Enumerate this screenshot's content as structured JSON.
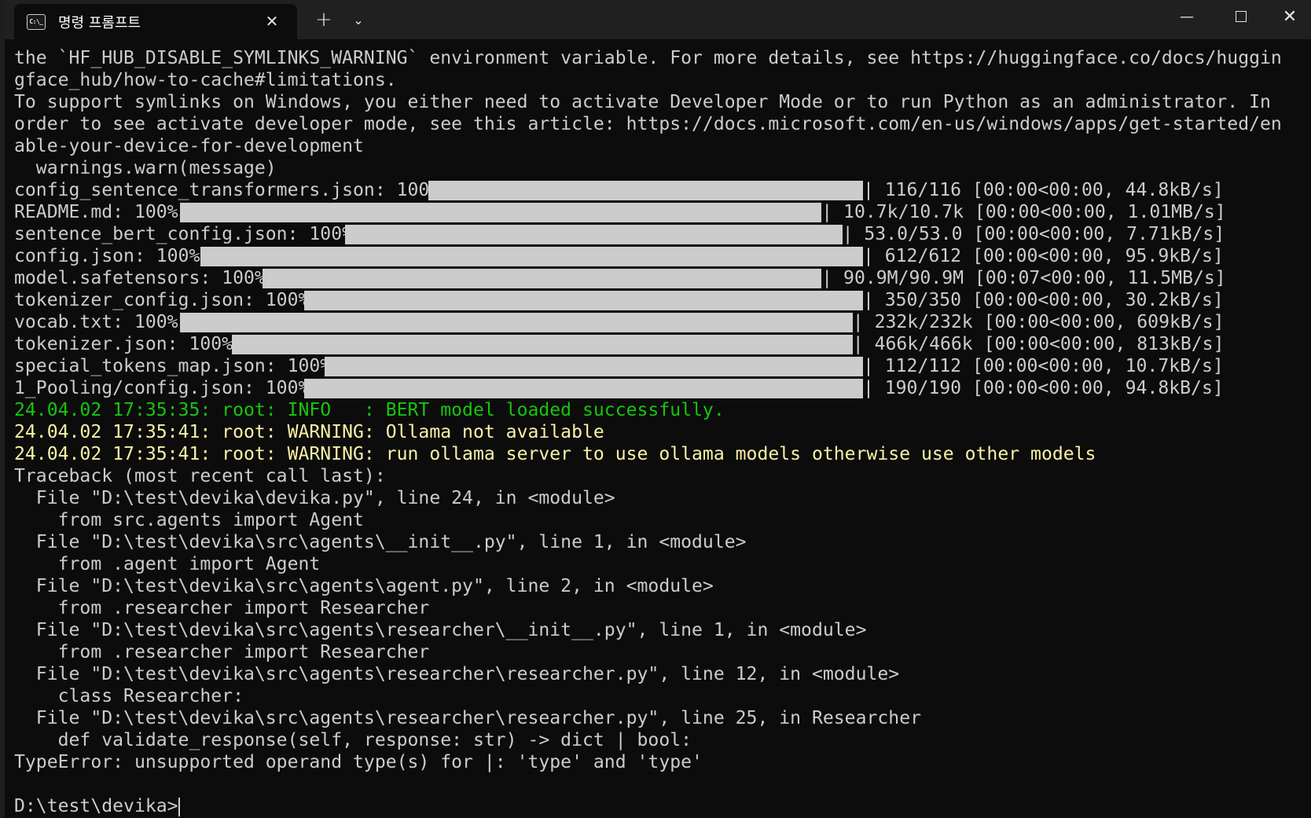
{
  "window": {
    "tab_title": "명령 프롬프트",
    "tab_icon_text": "C:\\_",
    "new_tab_symbol": "+",
    "dropdown_symbol": "⌄",
    "close_tab_symbol": "✕",
    "minimize_symbol": "—",
    "close_window_symbol": "✕"
  },
  "console": {
    "pre_lines": [
      "the `HF_HUB_DISABLE_SYMLINKS_WARNING` environment variable. For more details, see https://huggingface.co/docs/huggin",
      "gface_hub/how-to-cache#limitations.",
      "To support symlinks on Windows, you either need to activate Developer Mode or to run Python as an administrator. In",
      "order to see activate developer mode, see this article: https://docs.microsoft.com/en-us/windows/apps/get-started/en",
      "able-your-device-for-development",
      "  warnings.warn(message)"
    ],
    "downloads": [
      {
        "label": "config_sentence_transformers.json: 100%|",
        "stats": "| 116/116 [00:00<00:00, 44.8kB/s]",
        "progress": 1.0
      },
      {
        "label": "README.md: 100%|",
        "stats": "| 10.7k/10.7k [00:00<00:00, 1.01MB/s]",
        "progress": 1.0
      },
      {
        "label": "sentence_bert_config.json: 100%|",
        "stats": "| 53.0/53.0 [00:00<00:00, 7.71kB/s]",
        "progress": 1.0
      },
      {
        "label": "config.json: 100%|",
        "stats": "| 612/612 [00:00<00:00, 95.9kB/s]",
        "progress": 1.0
      },
      {
        "label": "model.safetensors: 100%|",
        "stats": "| 90.9M/90.9M [00:07<00:00, 11.5MB/s]",
        "progress": 1.0
      },
      {
        "label": "tokenizer_config.json: 100%|",
        "stats": "| 350/350 [00:00<00:00, 30.2kB/s]",
        "progress": 1.0
      },
      {
        "label": "vocab.txt: 100%|",
        "stats": "| 232k/232k [00:00<00:00, 609kB/s]",
        "progress": 1.0
      },
      {
        "label": "tokenizer.json: 100%|",
        "stats": "| 466k/466k [00:00<00:00, 813kB/s]",
        "progress": 1.0
      },
      {
        "label": "special_tokens_map.json: 100%|",
        "stats": "| 112/112 [00:00<00:00, 10.7kB/s]",
        "progress": 1.0
      },
      {
        "label": "1_Pooling/config.json: 100%|",
        "stats": "| 190/190 [00:00<00:00, 94.8kB/s]",
        "progress": 1.0
      }
    ],
    "log_lines": [
      {
        "text": "24.04.02 17:35:35: root: INFO   : BERT model loaded successfully.",
        "color": "#16c60c"
      },
      {
        "text": "24.04.02 17:35:41: root: WARNING: Ollama not available",
        "color": "#f9f1a5"
      },
      {
        "text": "24.04.02 17:35:41: root: WARNING: run ollama server to use ollama models otherwise use other models",
        "color": "#f9f1a5"
      }
    ],
    "traceback_lines": [
      "Traceback (most recent call last):",
      "  File \"D:\\test\\devika\\devika.py\", line 24, in <module>",
      "    from src.agents import Agent",
      "  File \"D:\\test\\devika\\src\\agents\\__init__.py\", line 1, in <module>",
      "    from .agent import Agent",
      "  File \"D:\\test\\devika\\src\\agents\\agent.py\", line 2, in <module>",
      "    from .researcher import Researcher",
      "  File \"D:\\test\\devika\\src\\agents\\researcher\\__init__.py\", line 1, in <module>",
      "    from .researcher import Researcher",
      "  File \"D:\\test\\devika\\src\\agents\\researcher\\researcher.py\", line 12, in <module>",
      "    class Researcher:",
      "  File \"D:\\test\\devika\\src\\agents\\researcher\\researcher.py\", line 25, in Researcher",
      "    def validate_response(self, response: str) -> dict | bool:",
      "TypeError: unsupported operand type(s) for |: 'type' and 'type'",
      ""
    ],
    "prompt": "D:\\test\\devika>"
  },
  "colors": {
    "background": "#0c0c0c",
    "text": "#cccccc",
    "info_green": "#16c60c",
    "warning_yellow": "#f9f1a5",
    "titlebar": "#202020"
  }
}
